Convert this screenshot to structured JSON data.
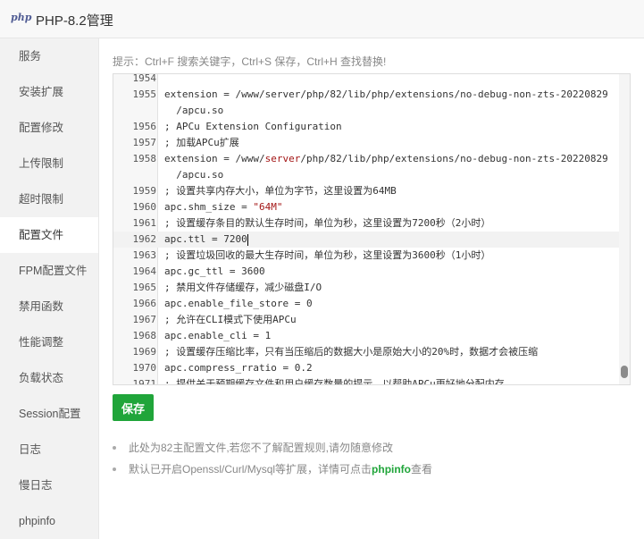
{
  "window": {
    "logo": "php",
    "title": "PHP-8.2管理"
  },
  "sidebar": {
    "items": [
      {
        "label": "服务"
      },
      {
        "label": "安装扩展"
      },
      {
        "label": "配置修改"
      },
      {
        "label": "上传限制"
      },
      {
        "label": "超时限制"
      },
      {
        "label": "配置文件"
      },
      {
        "label": "FPM配置文件"
      },
      {
        "label": "禁用函数"
      },
      {
        "label": "性能调整"
      },
      {
        "label": "负载状态"
      },
      {
        "label": "Session配置"
      },
      {
        "label": "日志"
      },
      {
        "label": "慢日志"
      },
      {
        "label": "phpinfo"
      }
    ],
    "active_index": 5
  },
  "hint": "提示：Ctrl+F 搜索关键字，Ctrl+S 保存，Ctrl+H 查找替换!",
  "editor": {
    "lines": [
      {
        "num": "1954",
        "code": ""
      },
      {
        "num": "1955",
        "code": "extension = /www/server/php/82/lib/php/extensions/no-debug-non-zts-20220829"
      },
      {
        "num": "",
        "code": "  /apcu.so"
      },
      {
        "num": "1956",
        "code": "; APCu Extension Configuration"
      },
      {
        "num": "1957",
        "code": "; 加载APCu扩展"
      },
      {
        "num": "1958",
        "pre": "extension = /www/",
        "str": "server",
        "post": "/php/82/lib/php/extensions/no-debug-non-zts-20220829"
      },
      {
        "num": "",
        "code": "  /apcu.so"
      },
      {
        "num": "1959",
        "code": "; 设置共享内存大小，单位为字节，这里设置为64MB"
      },
      {
        "num": "1960",
        "pre": "apc.shm_size = ",
        "str": "\"64M\"",
        "post": ""
      },
      {
        "num": "1961",
        "code": "; 设置缓存条目的默认生存时间，单位为秒，这里设置为7200秒（2小时）"
      },
      {
        "num": "1962",
        "code": "apc.ttl = 7200"
      },
      {
        "num": "1963",
        "code": "; 设置垃圾回收的最大生存时间，单位为秒，这里设置为3600秒（1小时）"
      },
      {
        "num": "1964",
        "code": "apc.gc_ttl = 3600"
      },
      {
        "num": "1965",
        "code": "; 禁用文件存储缓存，减少磁盘I/O"
      },
      {
        "num": "1966",
        "code": "apc.enable_file_store = 0"
      },
      {
        "num": "1967",
        "code": "; 允许在CLI模式下使用APCu"
      },
      {
        "num": "1968",
        "code": "apc.enable_cli = 1"
      },
      {
        "num": "1969",
        "code": "; 设置缓存压缩比率，只有当压缩后的数据大小是原始大小的20%时，数据才会被压缩"
      },
      {
        "num": "1970",
        "code": "apc.compress_rratio = 0.2"
      },
      {
        "num": "1971",
        "code": "; 提供关于预期缓存文件和用户缓存数量的提示，以帮助APCu更好地分配内存"
      }
    ],
    "active_line": 10
  },
  "save_label": "保存",
  "notes": {
    "line1": "此处为82主配置文件,若您不了解配置规则,请勿随意修改",
    "line2_prefix": "默认已开启Openssl/Curl/Mysql等扩展，详情可点击",
    "line2_link": "phpinfo",
    "line2_suffix": "查看"
  },
  "colors": {
    "accent": "#20a53a",
    "string": "#a31515"
  }
}
